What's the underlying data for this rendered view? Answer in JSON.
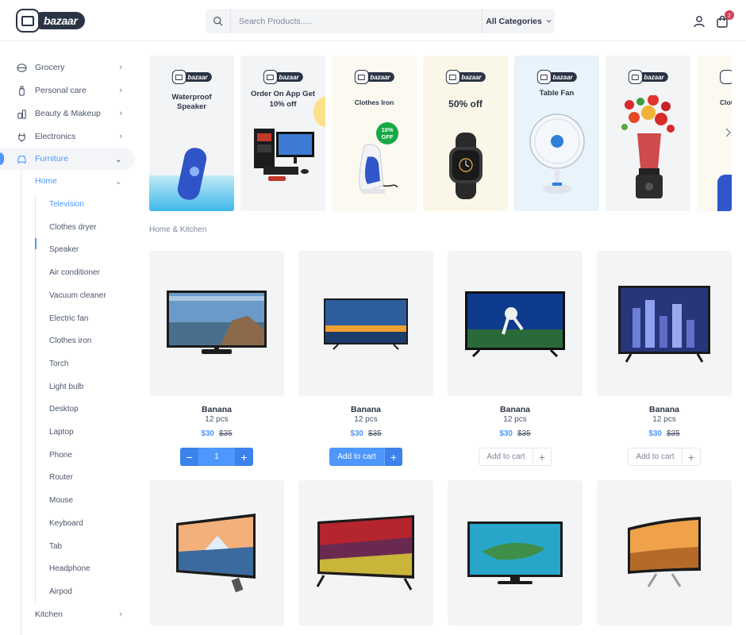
{
  "brand": {
    "name": "bazaar"
  },
  "search": {
    "placeholder": "Search Products.....",
    "category_label": "All Categories"
  },
  "header": {
    "cart_count": "2"
  },
  "sidebar": {
    "categories": [
      {
        "label": "Grocery",
        "icon": "grocery-icon"
      },
      {
        "label": "Personal care",
        "icon": "personal-care-icon"
      },
      {
        "label": "Beauty & Makeup",
        "icon": "beauty-icon"
      },
      {
        "label": "Electronics",
        "icon": "plug-icon"
      },
      {
        "label": "Furniture",
        "icon": "sofa-icon"
      }
    ],
    "sub": {
      "home": "Home",
      "kitchen": "Kitchen"
    },
    "home_items": [
      "Television",
      "Clothes dryer",
      "Speaker",
      "Air conditioner",
      "Vacuum cleaner",
      "Electric fan",
      "Clothes iron",
      "Torch",
      "Light bulb",
      "Desktop",
      "Laptop",
      "Phone",
      "Router",
      "Mouse",
      "Keyboard",
      "Tab",
      "Headphone",
      "Airpod"
    ]
  },
  "banners": [
    {
      "title": "Waterproof Speaker",
      "bg": "#f3f4f6"
    },
    {
      "title": "Order On App Get 10% off",
      "bg": "#f3f4f6"
    },
    {
      "title": "Clothes Iron",
      "badge": "10% OFF",
      "bg": "#fcf9f1"
    },
    {
      "title": "50% off",
      "bg": "#fbf7e8"
    },
    {
      "title": "Table Fan",
      "bg": "#e8f3fb"
    },
    {
      "title": "",
      "bg": "#f3f4f6"
    },
    {
      "title": "Clot",
      "bg": "#fcf9f1"
    }
  ],
  "section": {
    "label": "Home & Kitchen"
  },
  "products": [
    {
      "name": "Banana",
      "qty": "12 pcs",
      "price": "$30",
      "old_price": "$35",
      "control": "stepper",
      "count": "1"
    },
    {
      "name": "Banana",
      "qty": "12 pcs",
      "price": "$30",
      "old_price": "$35",
      "control": "add-blue",
      "add_label": "Add to cart"
    },
    {
      "name": "Banana",
      "qty": "12 pcs",
      "price": "$30",
      "old_price": "$35",
      "control": "add-outline",
      "add_label": "Add to cart"
    },
    {
      "name": "Banana",
      "qty": "12 pcs",
      "price": "$30",
      "old_price": "$35",
      "control": "add-outline",
      "add_label": "Add to cart"
    }
  ],
  "colors": {
    "accent": "#4e97fd",
    "text": "#2b3445",
    "badge": "#d23f57",
    "card_bg": "#f3f4f6"
  }
}
